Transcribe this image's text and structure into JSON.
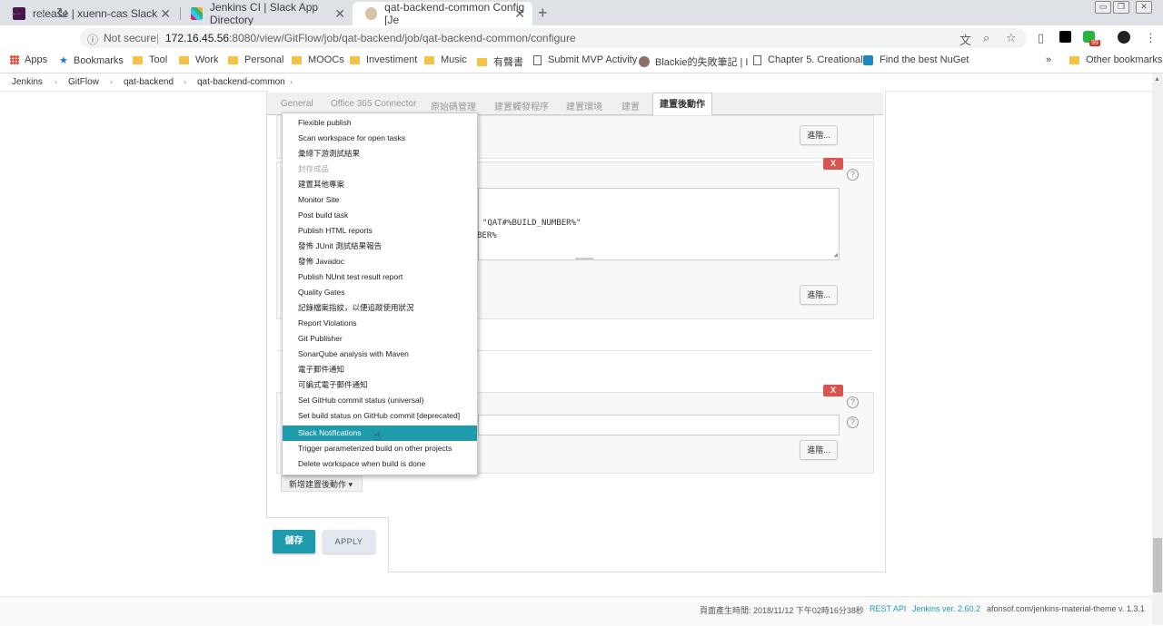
{
  "browser": {
    "tabs": [
      {
        "title": "release | xuenn-cas Slack",
        "close": "✕"
      },
      {
        "title": "Jenkins CI | Slack App Directory",
        "close": "✕"
      },
      {
        "title": "qat-backend-common Config [Je",
        "close": "✕"
      }
    ],
    "new_tab": "+",
    "url_security": "Not secure",
    "url_host": "172.16.45.56",
    "url_path": ":8080/view/GitFlow/job/qat-backend/job/qat-backend-common/configure",
    "extension_badge": "99",
    "bookmarks": [
      {
        "label": "Apps",
        "type": "apps"
      },
      {
        "label": "Bookmarks",
        "type": "star"
      },
      {
        "label": "Tool",
        "type": "folder"
      },
      {
        "label": "Work",
        "type": "folder"
      },
      {
        "label": "Personal",
        "type": "folder"
      },
      {
        "label": "MOOCs",
        "type": "folder"
      },
      {
        "label": "Investiment",
        "type": "folder"
      },
      {
        "label": "Music",
        "type": "folder"
      },
      {
        "label": "有聲書",
        "type": "folder"
      },
      {
        "label": "Submit MVP Activity",
        "type": "page"
      },
      {
        "label": "Blackie的失敗筆記 | I",
        "type": "avatar"
      },
      {
        "label": "Chapter 5. Creational",
        "type": "page"
      },
      {
        "label": "Find the best NuGet",
        "type": "nuget"
      }
    ],
    "bookmarks_more": "»",
    "other_bookmarks": "Other bookmarks"
  },
  "breadcrumb": [
    "Jenkins",
    "GitFlow",
    "qat-backend",
    "qat-backend-common"
  ],
  "config_tabs": [
    "General",
    "Office 365 Connector",
    "原始碼管理",
    "建置觸發程序",
    "建置環境",
    "建置",
    "建置後動作"
  ],
  "active_tab": "建置後動作",
  "advanced_label": "進階...",
  "delete_label": "X",
  "help_label": "?",
  "textarea_lines": [
    "\"QAT#%BUILD_NUMBER%\"",
    "BER%"
  ],
  "menu": {
    "items": [
      "Flexible publish",
      "Scan workspace for open tasks",
      "彙總下游測試結果",
      "封存成品",
      "建置其他專案",
      "Monitor Site",
      "Post build task",
      "Publish HTML reports",
      "發佈 JUnit 測試結果報告",
      "發佈 Javadoc",
      "Publish NUnit test result report",
      "Quality Gates",
      "記錄檔案指紋，以便追蹤使用狀況",
      "Report Violations",
      "Git Publisher",
      "SonarQube analysis with Maven",
      "電子郵件通知",
      "可編式電子郵件通知",
      "Set GitHub commit status (universal)",
      "Set build status on GitHub commit [deprecated]",
      "Slack Notifications",
      "Trigger parameterized build on other projects",
      "Delete workspace when build is done"
    ],
    "disabled_index": 3,
    "selected_index": 20
  },
  "add_post_build_action": "新增建置後動作",
  "save_label": "儲存",
  "apply_label": "APPLY",
  "footer": {
    "generated": "頁面產生時間: 2018/11/12 下午02時16分38秒",
    "rest_api": "REST API",
    "version": "Jenkins ver. 2.60.2",
    "theme": "afonsof.com/jenkins-material-theme v. 1.3.1"
  },
  "colors": {
    "accent": "#1f9bae",
    "danger": "#d9534f",
    "folder": "#f6c244"
  }
}
